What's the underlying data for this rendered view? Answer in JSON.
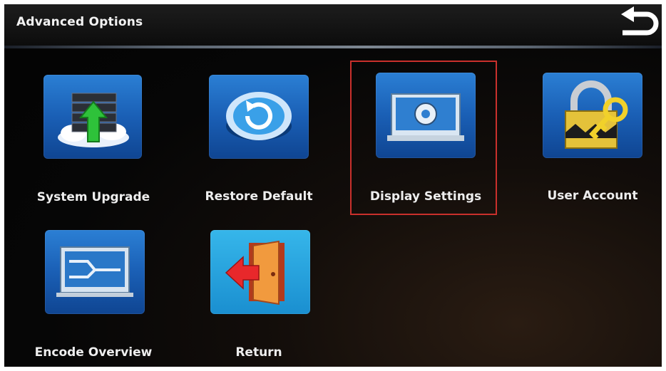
{
  "header": {
    "title": "Advanced Options",
    "back_icon": "return-arrow-icon"
  },
  "tiles": [
    {
      "label": "System Upgrade",
      "icon": "server-upgrade-icon"
    },
    {
      "label": "Restore Default",
      "icon": "restore-icon"
    },
    {
      "label": "Display Settings",
      "icon": "display-settings-icon",
      "selected": true
    },
    {
      "label": "User Account",
      "icon": "lock-key-icon"
    },
    {
      "label": "Encode Overview",
      "icon": "encode-overview-icon"
    },
    {
      "label": "Return",
      "icon": "exit-door-icon"
    }
  ],
  "colors": {
    "selection_border": "#c9302c",
    "tile_blue": "#1a5fb5"
  }
}
